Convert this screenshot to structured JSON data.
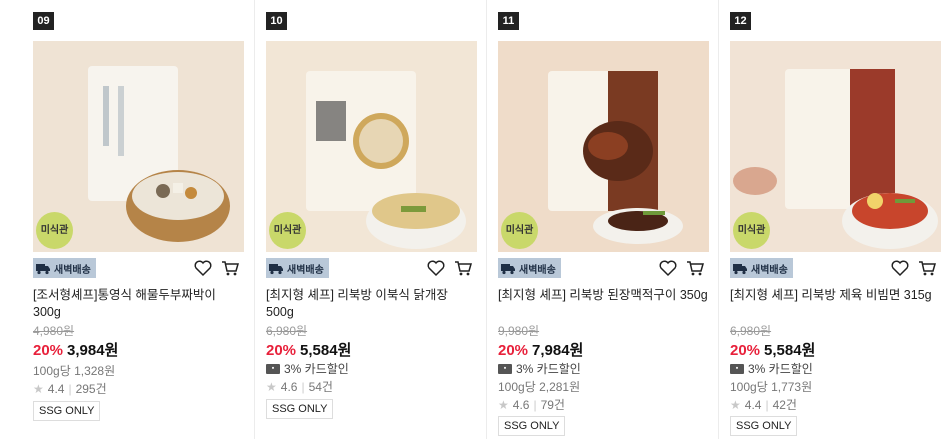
{
  "products": [
    {
      "rank": "09",
      "badge": "미식관",
      "delivery": "새벽배송",
      "title": "[조서형셰프]통영식 해물두부짜박이 300g",
      "original_price": "4,980원",
      "discount_pct": "20%",
      "sale_price": "3,984원",
      "unit_price": "100g당 1,328원",
      "rating": "4.4",
      "reviews": "295건",
      "tag": "SSG ONLY",
      "bg": "#efe3d4"
    },
    {
      "rank": "10",
      "badge": "미식관",
      "delivery": "새벽배송",
      "title": "[최지형 셰프] 리북방 이북식 닭개장 500g",
      "original_price": "6,980원",
      "discount_pct": "20%",
      "sale_price": "5,584원",
      "card_discount": "3% 카드할인",
      "rating": "4.6",
      "reviews": "54건",
      "tag": "SSG ONLY",
      "bg": "#f2e6d6"
    },
    {
      "rank": "11",
      "badge": "미식관",
      "delivery": "새벽배송",
      "title": "[최지형 셰프] 리북방 된장맥적구이 350g",
      "original_price": "9,980원",
      "discount_pct": "20%",
      "sale_price": "7,984원",
      "card_discount": "3% 카드할인",
      "unit_price": "100g당 2,281원",
      "rating": "4.6",
      "reviews": "79건",
      "tag": "SSG ONLY",
      "bg": "#efdcc9"
    },
    {
      "rank": "12",
      "badge": "미식관",
      "delivery": "새벽배송",
      "title": "[최지형 셰프] 리북방 제육 비빔면 315g",
      "original_price": "6,980원",
      "discount_pct": "20%",
      "sale_price": "5,584원",
      "card_discount": "3% 카드할인",
      "unit_price": "100g당 1,773원",
      "rating": "4.4",
      "reviews": "42건",
      "tag": "SSG ONLY",
      "bg": "#f1e3d5"
    }
  ],
  "colors": {
    "discount": "#e8213b",
    "badge": "#c9d86a",
    "delivery_bg": "#b9c8d8"
  }
}
